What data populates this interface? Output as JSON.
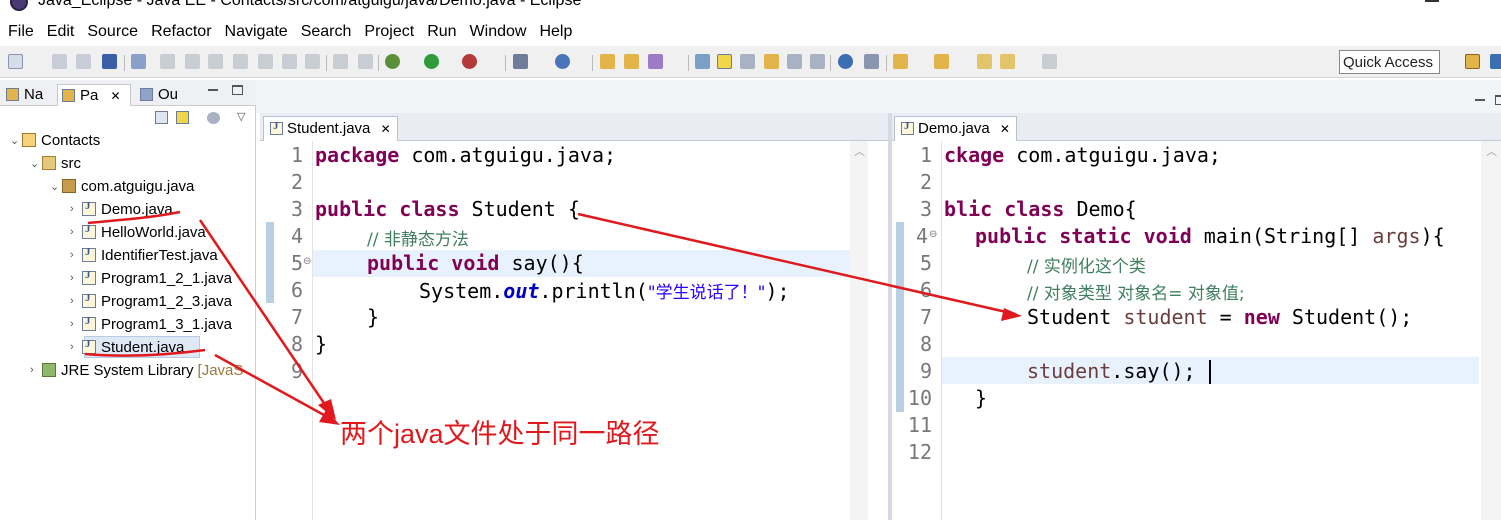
{
  "window": {
    "title": "Java_Eclipse - Java EE - Contacts/src/com/atguigu/java/Demo.java - Eclipse"
  },
  "menu": [
    "File",
    "Edit",
    "Source",
    "Refactor",
    "Navigate",
    "Search",
    "Project",
    "Run",
    "Window",
    "Help"
  ],
  "toolbar": {
    "quick_access": "Quick Access"
  },
  "left_tabs": [
    {
      "label": "Na",
      "icon": "navigator-icon"
    },
    {
      "label": "Pa",
      "icon": "package-explorer-icon",
      "close": "✕"
    },
    {
      "label": "Ou",
      "icon": "outline-icon"
    }
  ],
  "tree": {
    "project": "Contacts",
    "src": "src",
    "package": "com.atguigu.java",
    "files": [
      "Demo.java",
      "HelloWorld.java",
      "IdentifierTest.java",
      "Program1_2_1.java",
      "Program1_2_3.java",
      "Program1_3_1.java",
      "Student.java"
    ],
    "library": "JRE System Library",
    "library_suffix": "[JavaS"
  },
  "editor_student": {
    "tab": "Student.java",
    "close": "✕",
    "line_numbers": [
      "1",
      "2",
      "3",
      "4",
      "5",
      "6",
      "7",
      "8",
      "9"
    ],
    "lines": {
      "l1_kw": "package",
      "l1_rest": " com.atguigu.java;",
      "l3_kw1": "public",
      "l3_kw2": "class",
      "l3_rest": " Student {",
      "l4_comment": "// 非静态方法",
      "l5_kw1": "public",
      "l5_kw2": "void",
      "l5_rest": " say(){",
      "l6_a": "System.",
      "l6_field": "out",
      "l6_b": ".println(",
      "l6_str": "\"学生说话了！\"",
      "l6_c": ");",
      "l7": "}",
      "l8": "}"
    }
  },
  "editor_demo": {
    "tab": "Demo.java",
    "close": "✕",
    "line_numbers": [
      "1",
      "2",
      "3",
      "4",
      "5",
      "6",
      "7",
      "8",
      "9",
      "10",
      "11",
      "12"
    ],
    "lines": {
      "l1_kw": "ckage",
      "l1_rest": " com.atguigu.java;",
      "l3_kw1": "blic",
      "l3_kw2": "class",
      "l3_rest": " Demo{",
      "l4_kw1": "public",
      "l4_kw2": "static",
      "l4_kw3": "void",
      "l4_rest": " main(String[] ",
      "l4_var": "args",
      "l4_end": "){",
      "l5_comment": "// 实例化这个类",
      "l6_comment": "// 对象类型 对象名= 对象值;",
      "l7_a": "Student ",
      "l7_var": "student",
      "l7_b": " = ",
      "l7_kw": "new",
      "l7_c": " Student();",
      "l9_var": "student",
      "l9_rest": ".say();",
      "l10": "}"
    }
  },
  "annotation": {
    "text": "两个java文件处于同一路径",
    "color": "#e0191d"
  }
}
